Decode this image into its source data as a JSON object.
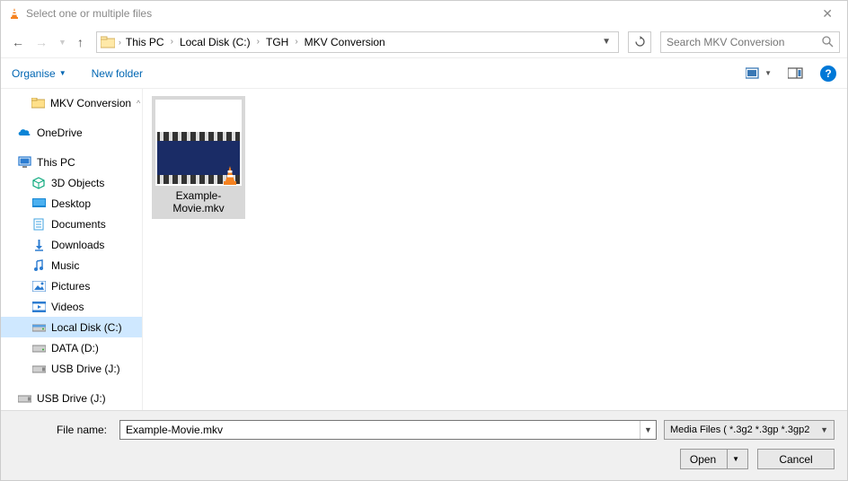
{
  "title": "Select one or multiple files",
  "breadcrumb": [
    "This PC",
    "Local Disk (C:)",
    "TGH",
    "MKV Conversion"
  ],
  "search_placeholder": "Search MKV Conversion",
  "toolbar": {
    "organise": "Organise",
    "new_folder": "New folder"
  },
  "sidebar": {
    "mkv": "MKV Conversion",
    "onedrive": "OneDrive",
    "this_pc": "This PC",
    "objects3d": "3D Objects",
    "desktop": "Desktop",
    "documents": "Documents",
    "downloads": "Downloads",
    "music": "Music",
    "pictures": "Pictures",
    "videos": "Videos",
    "local_disk": "Local Disk (C:)",
    "data": "DATA (D:)",
    "usb1": "USB Drive (J:)",
    "usb2": "USB Drive (J:)"
  },
  "file": {
    "name": "Example-Movie.mkv"
  },
  "footer": {
    "label": "File name:",
    "value": "Example-Movie.mkv",
    "filter": "Media Files ( *.3g2 *.3gp *.3gp2",
    "open": "Open",
    "cancel": "Cancel"
  }
}
